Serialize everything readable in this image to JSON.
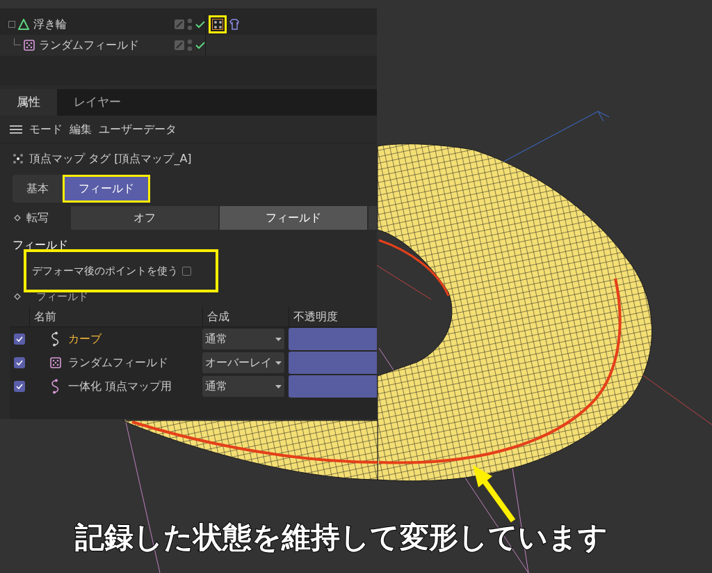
{
  "object_manager": {
    "rows": [
      {
        "name": "浮き輪",
        "kind": "object",
        "expandable": true,
        "enabled": true
      },
      {
        "name": "ランダムフィールド",
        "kind": "field",
        "expandable": false,
        "enabled": true
      }
    ]
  },
  "attributes": {
    "tabs": [
      {
        "label": "属性",
        "selected": true
      },
      {
        "label": "レイヤー",
        "selected": false
      }
    ],
    "menu": [
      "モード",
      "編集",
      "ユーザーデータ"
    ],
    "title": "頂点マップ タグ [頂点マップ_A]",
    "subtabs": [
      {
        "label": "基本",
        "selected": false
      },
      {
        "label": "フィールド",
        "selected": true
      }
    ],
    "transfer": {
      "label": "転写",
      "options": [
        {
          "label": "オフ",
          "selected": false
        },
        {
          "label": "フィールド",
          "selected": true
        }
      ]
    },
    "section": "フィールド",
    "use_deformed": {
      "label": "デフォーマ後のポイントを使う",
      "checked": false
    },
    "field_label": "フィールド",
    "columns": [
      "名前",
      "合成",
      "不透明度"
    ],
    "rows": [
      {
        "name": "カーブ",
        "kind": "spline",
        "enabled": true,
        "selected": true,
        "blend": "通常"
      },
      {
        "name": "ランダムフィールド",
        "kind": "random",
        "enabled": true,
        "selected": false,
        "blend": "オーバーレイ"
      },
      {
        "name": "一体化 頂点マップ用",
        "kind": "spline",
        "enabled": true,
        "selected": false,
        "blend": "通常"
      }
    ]
  },
  "caption": "記録した状態を維持して変形しています"
}
